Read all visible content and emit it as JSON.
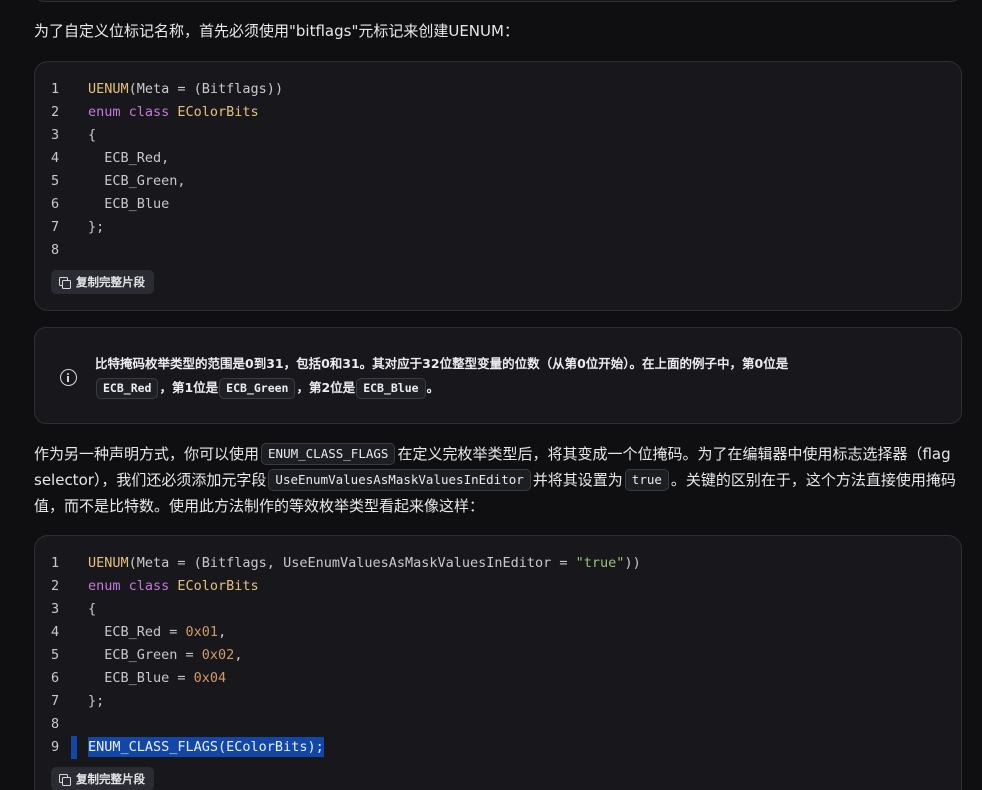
{
  "intro": {
    "text": "为了自定义位标记名称，首先必须使用\"bitflags\"元标记来创建UENUM："
  },
  "code1": {
    "lines": [
      {
        "n": "1",
        "parts": [
          [
            "ty",
            "UENUM"
          ],
          [
            "",
            "(Meta = (Bitflags))"
          ]
        ]
      },
      {
        "n": "2",
        "parts": [
          [
            "kw",
            "enum class "
          ],
          [
            "ty",
            "EColorBits"
          ]
        ]
      },
      {
        "n": "3",
        "parts": [
          [
            "",
            "{"
          ]
        ]
      },
      {
        "n": "4",
        "parts": [
          [
            "",
            "  ECB_Red,"
          ]
        ]
      },
      {
        "n": "5",
        "parts": [
          [
            "",
            "  ECB_Green,"
          ]
        ]
      },
      {
        "n": "6",
        "parts": [
          [
            "",
            "  ECB_Blue"
          ]
        ]
      },
      {
        "n": "7",
        "parts": [
          [
            "",
            "};"
          ]
        ]
      },
      {
        "n": "8",
        "parts": [
          [
            "",
            ""
          ]
        ]
      }
    ],
    "copy_label": "复制完整片段"
  },
  "note": {
    "icon": "info-icon",
    "seg1": "比特掩码枚举类型的范围是0到31，包括0和31。其对应于32位整型变量的位数（从第0位开始）。在上面的例子中，第0位是",
    "code_a": "ECB_Red",
    "seg2": "，第1位是",
    "code_b": "ECB_Green",
    "seg3": "，第2位是",
    "code_c": "ECB_Blue",
    "seg4": "。"
  },
  "para2": {
    "seg1": "作为另一种声明方式，你可以使用",
    "code_a": "ENUM_CLASS_FLAGS",
    "seg2": "在定义完枚举类型后，将其变成一个位掩码。为了在编辑器中使用标志选择器（flag selector），我们还必须添加元字段",
    "code_b": "UseEnumValuesAsMaskValuesInEditor",
    "seg3": "并将其设置为",
    "code_c": "true",
    "seg4": "。关键的区别在于，这个方法直接使用掩码值，而不是比特数。使用此方法制作的等效枚举类型看起来像这样："
  },
  "code2": {
    "lines": [
      {
        "n": "1",
        "parts": [
          [
            "ty",
            "UENUM"
          ],
          [
            "",
            "(Meta = (Bitflags, UseEnumValuesAsMaskValuesInEditor = "
          ],
          [
            "st",
            "\"true\""
          ],
          [
            "",
            "))"
          ]
        ]
      },
      {
        "n": "2",
        "parts": [
          [
            "kw",
            "enum class "
          ],
          [
            "ty",
            "EColorBits"
          ]
        ]
      },
      {
        "n": "3",
        "parts": [
          [
            "",
            "{"
          ]
        ]
      },
      {
        "n": "4",
        "parts": [
          [
            "",
            "  ECB_Red = "
          ],
          [
            "nm",
            "0x01"
          ],
          [
            "",
            ","
          ]
        ]
      },
      {
        "n": "5",
        "parts": [
          [
            "",
            "  ECB_Green = "
          ],
          [
            "nm",
            "0x02"
          ],
          [
            "",
            ","
          ]
        ]
      },
      {
        "n": "6",
        "parts": [
          [
            "",
            "  ECB_Blue = "
          ],
          [
            "nm",
            "0x04"
          ]
        ]
      },
      {
        "n": "7",
        "parts": [
          [
            "",
            "};"
          ]
        ]
      },
      {
        "n": "8",
        "parts": [
          [
            "",
            ""
          ]
        ]
      },
      {
        "n": "9",
        "parts": [
          [
            "hl",
            "ENUM_CLASS_FLAGS(EColorBits);"
          ]
        ]
      }
    ],
    "copy_label": "复制完整片段"
  }
}
